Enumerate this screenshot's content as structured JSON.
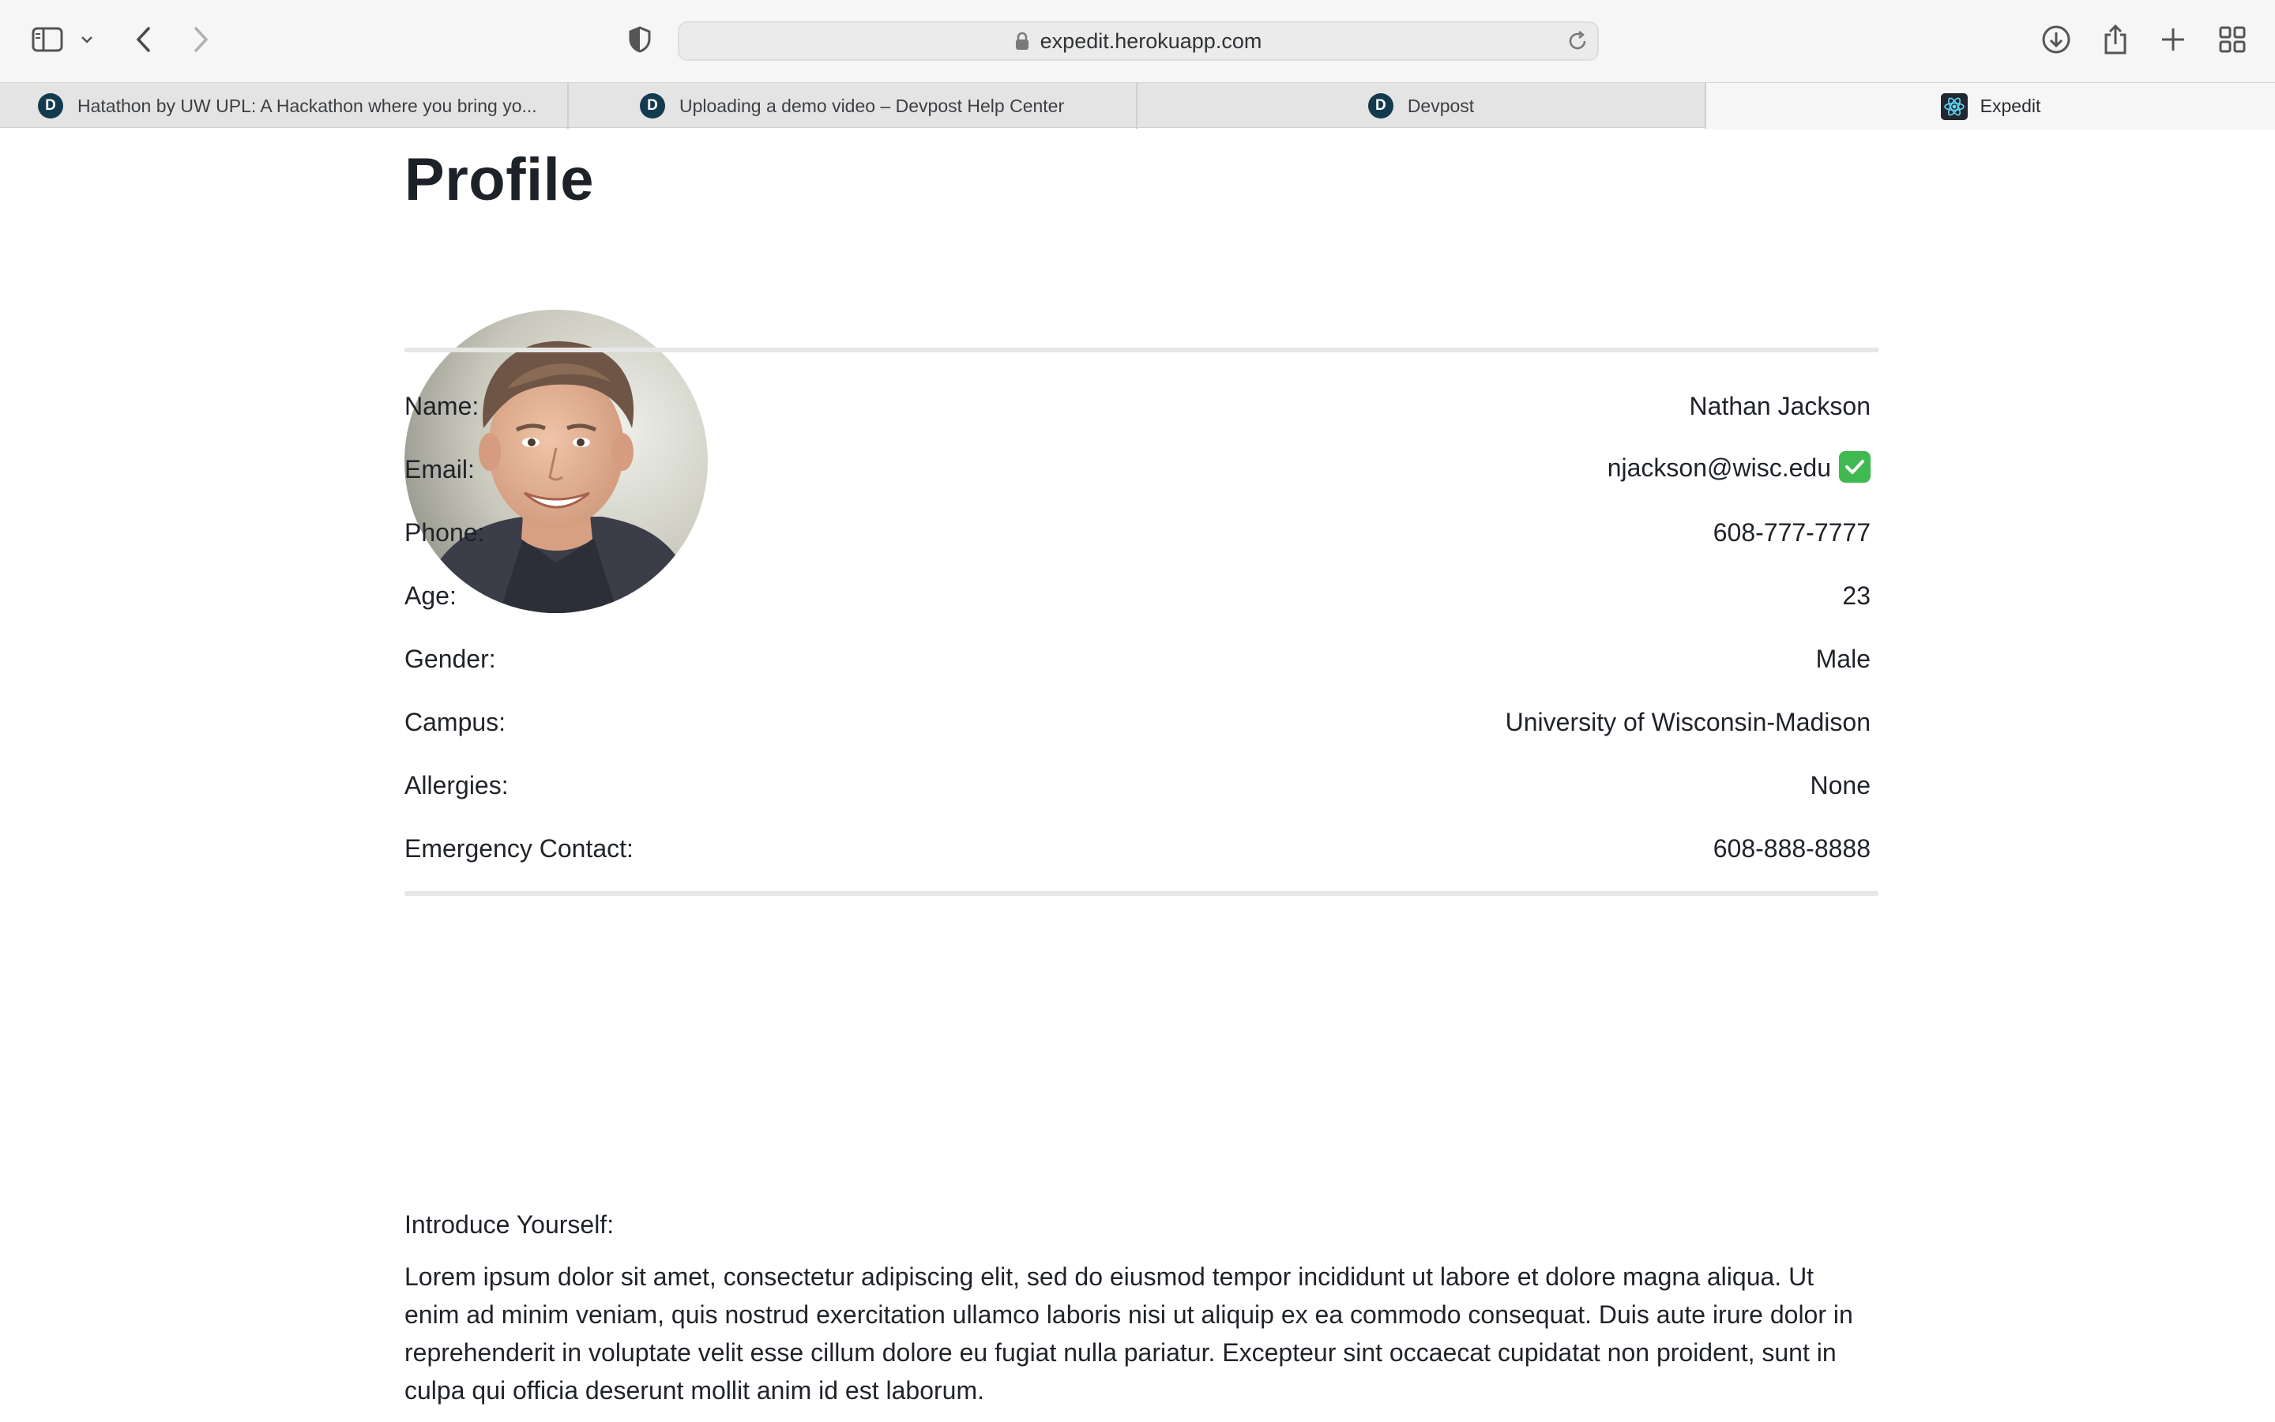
{
  "browser": {
    "url": "expedit.herokuapp.com",
    "tabs": [
      {
        "label": "Hatathon by UW UPL: A Hackathon where you bring yo...",
        "favicon": "devpost-icon"
      },
      {
        "label": "Uploading a demo video – Devpost Help Center",
        "favicon": "devpost-icon"
      },
      {
        "label": "Devpost",
        "favicon": "devpost-icon"
      },
      {
        "label": "Expedit",
        "favicon": "react-icon"
      }
    ],
    "favicon_letter": "D"
  },
  "profile": {
    "title": "Profile",
    "fields": [
      {
        "label": "Name:",
        "value": "Nathan Jackson"
      },
      {
        "label": "Email:",
        "value": "njackson@wisc.edu",
        "verified": true
      },
      {
        "label": "Phone:",
        "value": "608-777-7777"
      },
      {
        "label": "Age:",
        "value": "23"
      },
      {
        "label": "Gender:",
        "value": "Male"
      },
      {
        "label": "Campus:",
        "value": "University of Wisconsin-Madison"
      },
      {
        "label": "Allergies:",
        "value": "None"
      },
      {
        "label": "Emergency Contact:",
        "value": "608-888-8888"
      }
    ],
    "intro_label": "Introduce Yourself:",
    "intro_text": "Lorem ipsum dolor sit amet, consectetur adipiscing elit, sed do eiusmod tempor incididunt ut labore et dolore magna aliqua. Ut enim ad minim veniam, quis nostrud exercitation ullamco laboris nisi ut aliquip ex ea commodo consequat. Duis aute irure dolor in reprehenderit in voluptate velit esse cillum dolore eu fugiat nulla pariatur. Excepteur sint occaecat cupidatat non proident, sunt in culpa qui officia deserunt mollit anim id est laborum."
  },
  "colors": {
    "verified_badge": "#3fb950",
    "devpost_favicon": "#133a4e"
  }
}
